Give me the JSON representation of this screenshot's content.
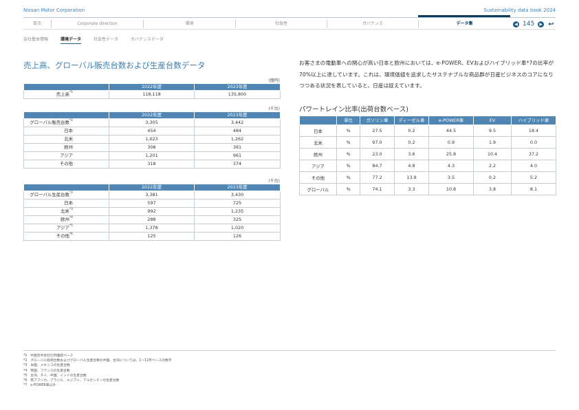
{
  "header": {
    "company": "Nissan Motor Corporation",
    "book": "Sustainability data book 2024"
  },
  "tabs": [
    {
      "label": "目次",
      "active": false
    },
    {
      "label": "Corporate direction",
      "active": false
    },
    {
      "label": "環境",
      "active": false
    },
    {
      "label": "社会性",
      "active": false
    },
    {
      "label": "ガバナンス",
      "active": false
    },
    {
      "label": "データ集",
      "active": true
    }
  ],
  "pager": {
    "page": "145"
  },
  "subnav": [
    "会社基本情報",
    "環境データ",
    "社会性データ",
    "ガバナンスデータ"
  ],
  "section_title": "売上高、グローバル販売台数および生産台数データ",
  "sales": {
    "unit": "(億円)",
    "col1": "2022年度",
    "col2": "2023年度",
    "rows": [
      {
        "label": "売上高",
        "note": "*1",
        "v1": "118,118",
        "v2": "135,800"
      }
    ]
  },
  "global_sales": {
    "unit": "(千台)",
    "col1": "2022年度",
    "col2": "2023年度",
    "rows": [
      {
        "label": "グローバル販売台数",
        "note": "*2",
        "v1": "3,305",
        "v2": "3,442"
      },
      {
        "label": "日本",
        "note": "",
        "v1": "454",
        "v2": "484"
      },
      {
        "label": "北米",
        "note": "",
        "v1": "1,023",
        "v2": "1,262"
      },
      {
        "label": "欧州",
        "note": "",
        "v1": "308",
        "v2": "361"
      },
      {
        "label": "アジア",
        "note": "",
        "v1": "1,201",
        "v2": "961"
      },
      {
        "label": "その他",
        "note": "",
        "v1": "318",
        "v2": "374"
      }
    ]
  },
  "production": {
    "unit": "(千台)",
    "col1": "2022年度",
    "col2": "2023年度",
    "rows": [
      {
        "label": "グローバル生産台数",
        "note": "*2",
        "v1": "3,381",
        "v2": "3,430"
      },
      {
        "label": "日本",
        "note": "",
        "v1": "597",
        "v2": "725"
      },
      {
        "label": "北米",
        "note": "*3",
        "v1": "992",
        "v2": "1,235"
      },
      {
        "label": "欧州",
        "note": "*4",
        "v1": "288",
        "v2": "325"
      },
      {
        "label": "アジア",
        "note": "*5",
        "v1": "1,378",
        "v2": "1,020"
      },
      {
        "label": "その他",
        "note": "*6",
        "v1": "125",
        "v2": "126"
      }
    ]
  },
  "paragraph": "お客さまの電動車への関心が高い日本と欧州においては、e-POWER、EVおよびハイブリッド車*7の比率が70%以上に達しています。これは、環境価値を追求したサステナブルな商品群が日産ビジネスのコアになりつつある状況を表していると、日産は捉えています。",
  "powertrain": {
    "title": "パワートレイン比率(出荷台数ベース)",
    "headers": [
      "",
      "単位",
      "ガソリン車",
      "ディーゼル車",
      "e-POWER車",
      "EV",
      "ハイブリッド車"
    ],
    "rows": [
      [
        "日本",
        "%",
        "27.5",
        "0.2",
        "44.5",
        "9.5",
        "18.4"
      ],
      [
        "北米",
        "%",
        "97.0",
        "0.2",
        "0.9",
        "1.9",
        "0.0"
      ],
      [
        "欧州",
        "%",
        "23.0",
        "3.6",
        "25.8",
        "10.4",
        "37.2"
      ],
      [
        "アジア",
        "%",
        "84.7",
        "4.8",
        "4.3",
        "2.2",
        "4.0"
      ],
      [
        "その他",
        "%",
        "77.2",
        "13.9",
        "3.5",
        "0.2",
        "5.2"
      ],
      [
        "グローバル",
        "%",
        "74.1",
        "3.3",
        "10.8",
        "3.8",
        "8.1"
      ]
    ]
  },
  "footnotes": [
    "*1　中国合弁会社比例連結ベース",
    "*2　グローバル販売台数およびグローバル生産台数の中国、台湾については、1～12月ベースの数字",
    "*3　米国、メキシコの生産台数",
    "*4　英国、フランスの生産台数",
    "*5　台湾、タイ、中国、インドの生産台数",
    "*6　南アフリカ、ブラジル、エジプト、アルゼンチンの生産台数",
    "*7　e-POWER車以外"
  ]
}
